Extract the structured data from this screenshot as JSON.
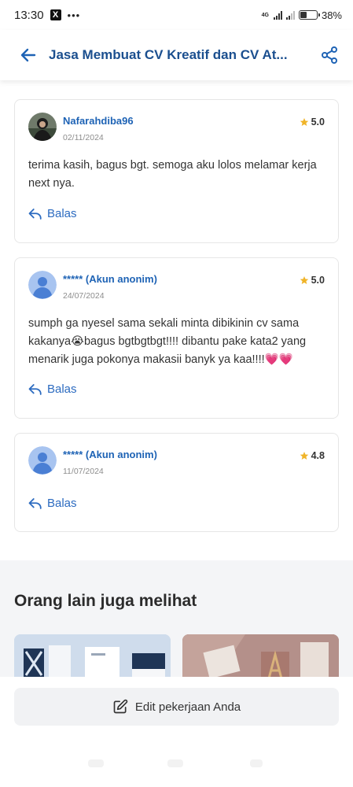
{
  "status_bar": {
    "time": "13:30",
    "battery": "38%",
    "battery_level": 0.38,
    "network": "4G"
  },
  "header": {
    "title": "Jasa Membuat CV Kreatif dan CV At..."
  },
  "reviews": [
    {
      "name": "Nafarahdiba96",
      "date": "02/11/2024",
      "rating": "5.0",
      "text": "terima kasih, bagus bgt. semoga aku lolos melamar kerja next nya.",
      "reply_label": "Balas",
      "avatar": "photo-avatar"
    },
    {
      "name": "***** (Akun anonim)",
      "date": "24/07/2024",
      "rating": "5.0",
      "text": "sumph ga nyesel sama sekali minta dibikinin cv sama kakanya😭bagus bgtbgtbgt!!!! dibantu pake kata2 yang menarik juga pokonya makasii banyk ya kaa!!!!💗💗",
      "reply_label": "Balas",
      "avatar": "default-user-avatar"
    },
    {
      "name": "***** (Akun anonim)",
      "date": "11/07/2024",
      "rating": "4.8",
      "text": "",
      "reply_label": "Balas",
      "avatar": "default-user-avatar"
    }
  ],
  "others": {
    "title": "Orang lain juga melihat"
  },
  "bottom": {
    "edit_label": "Edit pekerjaan Anda"
  },
  "colors": {
    "primary": "#1b4f8f",
    "link": "#2c6bc0",
    "star": "#f0b429"
  },
  "icons": [
    "back-arrow-icon",
    "share-icon",
    "star-icon",
    "reply-icon",
    "edit-icon",
    "user-icon"
  ]
}
